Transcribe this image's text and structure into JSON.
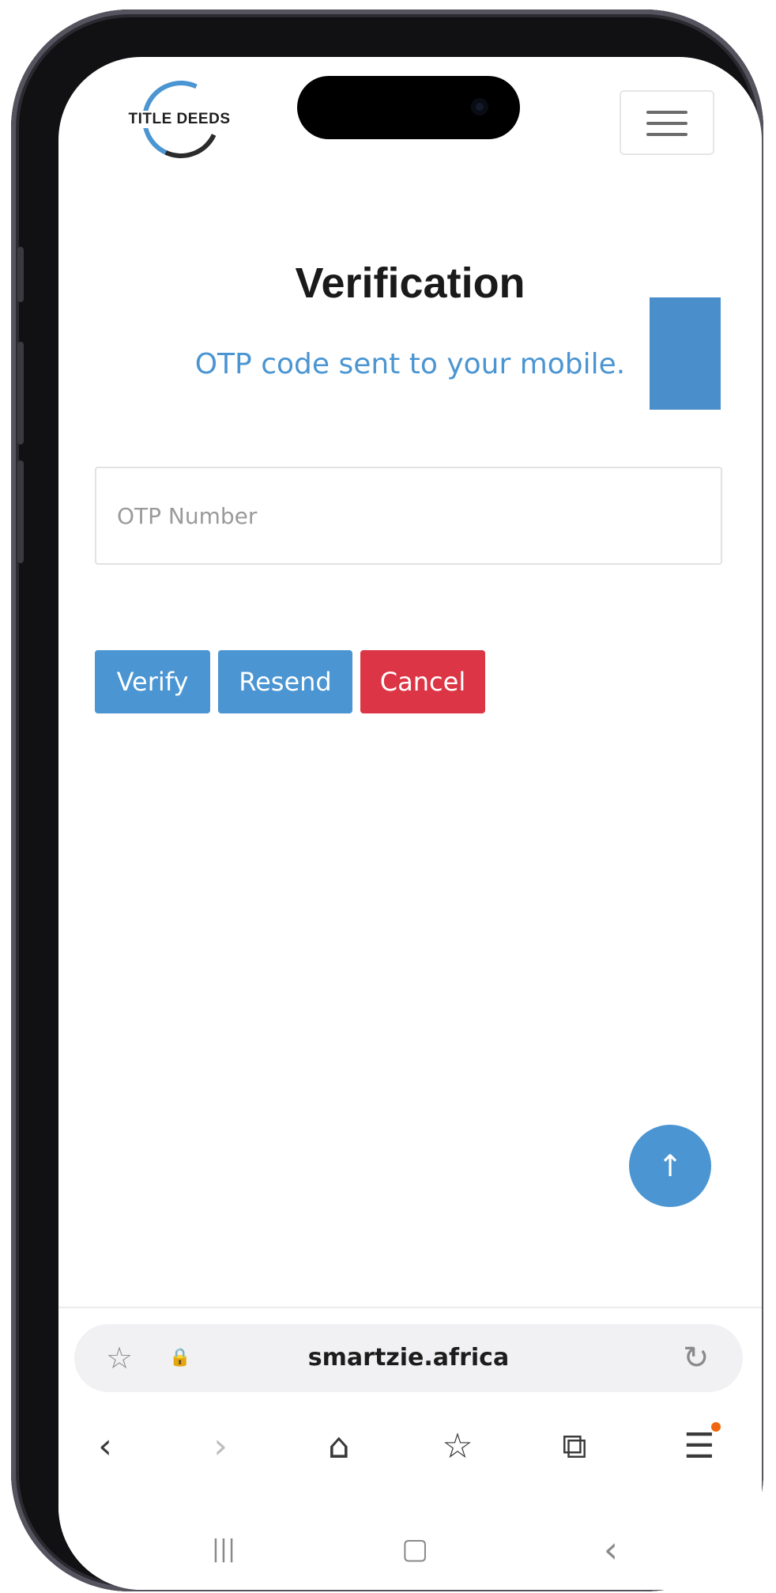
{
  "header": {
    "logo_text": "TITLE DEEDS",
    "menu_icon": "hamburger-menu-icon"
  },
  "verification": {
    "title": "Verification",
    "subtitle": "OTP code sent to your mobile.",
    "otp_placeholder": "OTP Number",
    "otp_value": ""
  },
  "buttons": {
    "verify": "Verify",
    "resend": "Resend",
    "cancel": "Cancel"
  },
  "scroll_top": {
    "glyph": "↑",
    "icon": "arrow-up-icon"
  },
  "browser": {
    "url": "smartzie.africa",
    "url_icons": {
      "bookmark": "☆",
      "lock": "🔒",
      "reload": "↻"
    },
    "nav": {
      "back": "‹",
      "forward": "›",
      "home": "⌂",
      "bookmarks": "☆",
      "tabs": "⧉",
      "menu": "☰"
    },
    "system": {
      "recents": "|||",
      "home": "▢",
      "back": "‹"
    }
  },
  "colors": {
    "primary": "#4a95d2",
    "danger": "#dc3545",
    "badge": "#f0660d"
  }
}
